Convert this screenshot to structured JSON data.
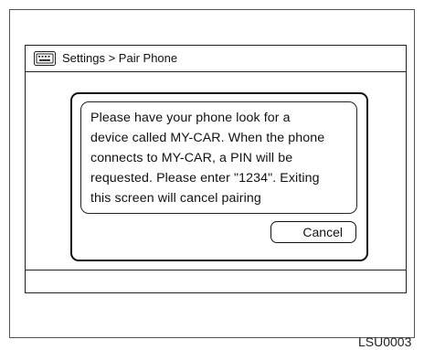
{
  "header": {
    "icon": "keyboard-icon",
    "breadcrumb": "Settings > Pair Phone"
  },
  "dialog": {
    "message_lines": [
      "Please have your phone look for a",
      "device called MY-CAR. When the phone",
      "connects to MY-CAR, a PIN will be",
      "requested. Please enter \"1234\". Exiting",
      "this screen will cancel pairing"
    ],
    "cancel_label": "Cancel"
  },
  "figure_code": "LSU0003"
}
